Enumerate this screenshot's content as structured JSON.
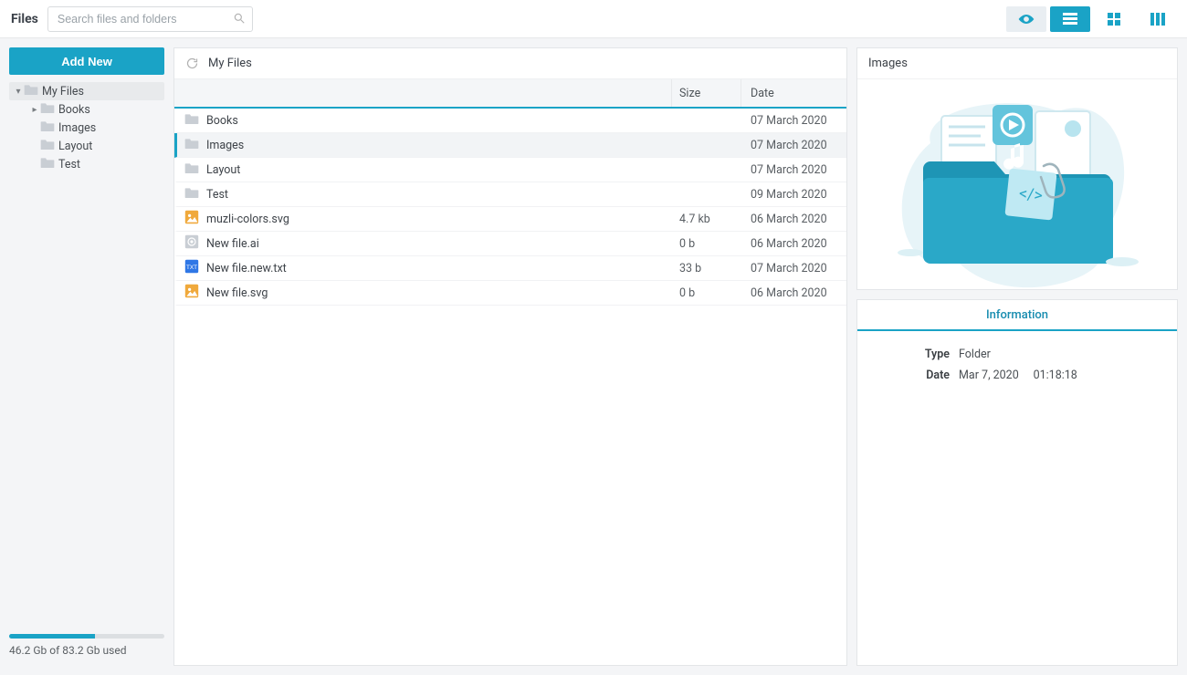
{
  "topbar": {
    "title": "Files",
    "search_placeholder": "Search files and folders"
  },
  "sidebar": {
    "add_new_label": "Add New",
    "tree": [
      {
        "label": "My Files",
        "depth": 0,
        "expanded": true,
        "selected": true,
        "hasChildren": true
      },
      {
        "label": "Books",
        "depth": 1,
        "expanded": false,
        "selected": false,
        "hasChildren": true
      },
      {
        "label": "Images",
        "depth": 1,
        "expanded": false,
        "selected": false,
        "hasChildren": false
      },
      {
        "label": "Layout",
        "depth": 1,
        "expanded": false,
        "selected": false,
        "hasChildren": false
      },
      {
        "label": "Test",
        "depth": 1,
        "expanded": false,
        "selected": false,
        "hasChildren": false
      }
    ],
    "storage": {
      "text": "46.2 Gb of 83.2 Gb used",
      "percent": 55
    }
  },
  "main": {
    "breadcrumb": "My Files",
    "columns": {
      "name": "",
      "size": "Size",
      "date": "Date"
    },
    "rows": [
      {
        "kind": "folder",
        "name": "Books",
        "size": "",
        "date": "07 March 2020",
        "selected": false
      },
      {
        "kind": "folder",
        "name": "Images",
        "size": "",
        "date": "07 March 2020",
        "selected": true
      },
      {
        "kind": "folder",
        "name": "Layout",
        "size": "",
        "date": "07 March 2020",
        "selected": false
      },
      {
        "kind": "folder",
        "name": "Test",
        "size": "",
        "date": "09 March 2020",
        "selected": false
      },
      {
        "kind": "svg",
        "name": "muzli-colors.svg",
        "size": "4.7 kb",
        "date": "06 March 2020",
        "selected": false
      },
      {
        "kind": "ai",
        "name": "New file.ai",
        "size": "0 b",
        "date": "06 March 2020",
        "selected": false
      },
      {
        "kind": "txt",
        "name": "New file.new.txt",
        "size": "33 b",
        "date": "07 March 2020",
        "selected": false
      },
      {
        "kind": "svg",
        "name": "New file.svg",
        "size": "0 b",
        "date": "06 March 2020",
        "selected": false
      }
    ]
  },
  "preview": {
    "title": "Images"
  },
  "info": {
    "tab_label": "Information",
    "rows": [
      {
        "key": "Type",
        "val": "Folder"
      },
      {
        "key": "Date",
        "val": "Mar 7, 2020  01:18:18"
      }
    ]
  }
}
